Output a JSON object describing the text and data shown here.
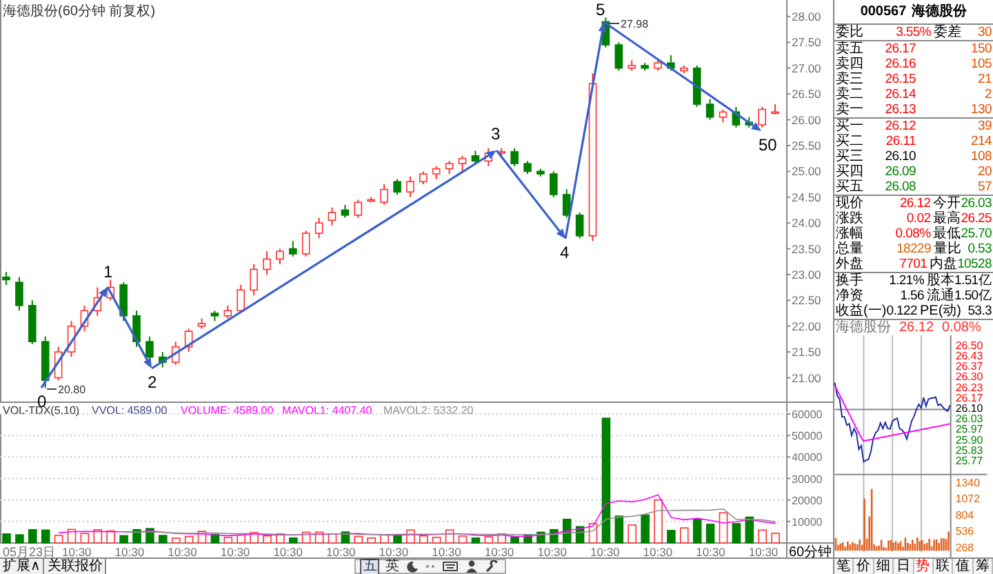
{
  "chart": {
    "title": "海德股份(60分钟 前复权)",
    "chart_data": {
      "type": "candlestick",
      "ylim": [
        20.54,
        28.32
      ],
      "yticks": [
        {
          "value": 28,
          "label": "28.00"
        },
        {
          "value": 27.5,
          "label": "27.50"
        },
        {
          "value": 27,
          "label": "27.00"
        },
        {
          "value": 26.5,
          "label": "26.50"
        },
        {
          "value": 26,
          "label": "26.00"
        },
        {
          "value": 25.5,
          "label": "25.50"
        },
        {
          "value": 25,
          "label": "25.00"
        },
        {
          "value": 24.5,
          "label": "24.50"
        },
        {
          "value": 24,
          "label": "24.00"
        },
        {
          "value": 23.5,
          "label": "23.50"
        },
        {
          "value": 23,
          "label": "23.00"
        },
        {
          "value": 22.5,
          "label": "22.50"
        },
        {
          "value": 22,
          "label": "22.00"
        },
        {
          "value": 21.5,
          "label": "21.50"
        },
        {
          "value": 21,
          "label": "21.00"
        }
      ],
      "ohlc": [
        [
          22.95,
          23.05,
          22.8,
          22.9
        ],
        [
          22.85,
          22.95,
          22.3,
          22.4
        ],
        [
          22.4,
          22.5,
          21.65,
          21.7
        ],
        [
          21.7,
          21.8,
          20.8,
          20.95
        ],
        [
          21.0,
          21.6,
          20.95,
          21.5
        ],
        [
          21.5,
          22.1,
          21.4,
          22.0
        ],
        [
          22.0,
          22.4,
          21.9,
          22.3
        ],
        [
          22.3,
          22.75,
          22.2,
          22.55
        ],
        [
          22.55,
          22.9,
          22.5,
          22.75
        ],
        [
          22.8,
          22.85,
          22.1,
          22.2
        ],
        [
          22.2,
          22.3,
          21.6,
          21.7
        ],
        [
          21.7,
          21.8,
          21.3,
          21.4
        ],
        [
          21.4,
          21.5,
          21.2,
          21.3
        ],
        [
          21.3,
          21.7,
          21.25,
          21.6
        ],
        [
          21.6,
          21.95,
          21.5,
          21.9
        ],
        [
          22.0,
          22.15,
          21.95,
          22.05
        ],
        [
          22.25,
          22.3,
          22.1,
          22.2
        ],
        [
          22.2,
          22.4,
          22.15,
          22.3
        ],
        [
          22.3,
          22.8,
          22.25,
          22.7
        ],
        [
          22.7,
          23.2,
          22.6,
          23.1
        ],
        [
          23.1,
          23.45,
          23.0,
          23.3
        ],
        [
          23.3,
          23.5,
          23.2,
          23.45
        ],
        [
          23.5,
          23.65,
          23.35,
          23.4
        ],
        [
          23.4,
          23.85,
          23.35,
          23.8
        ],
        [
          23.8,
          24.1,
          23.7,
          24.0
        ],
        [
          24.05,
          24.3,
          23.95,
          24.2
        ],
        [
          24.25,
          24.35,
          24.1,
          24.15
        ],
        [
          24.15,
          24.45,
          24.1,
          24.4
        ],
        [
          24.45,
          24.5,
          24.4,
          24.45
        ],
        [
          24.4,
          24.75,
          24.35,
          24.65
        ],
        [
          24.8,
          24.85,
          24.55,
          24.6
        ],
        [
          24.6,
          24.9,
          24.5,
          24.8
        ],
        [
          24.8,
          25.0,
          24.75,
          24.95
        ],
        [
          24.95,
          25.1,
          24.85,
          25.05
        ],
        [
          25.05,
          25.2,
          24.95,
          25.15
        ],
        [
          25.15,
          25.3,
          25.0,
          25.25
        ],
        [
          25.3,
          25.4,
          25.15,
          25.2
        ],
        [
          25.2,
          25.45,
          25.1,
          25.35
        ],
        [
          25.36,
          25.45,
          25.3,
          25.38
        ],
        [
          25.38,
          25.45,
          25.1,
          25.15
        ],
        [
          25.15,
          25.2,
          24.95,
          25.0
        ],
        [
          25.0,
          25.05,
          24.9,
          24.95
        ],
        [
          24.95,
          25.0,
          24.5,
          24.55
        ],
        [
          24.55,
          24.65,
          24.1,
          24.15
        ],
        [
          24.15,
          24.2,
          23.7,
          23.75
        ],
        [
          23.75,
          26.9,
          23.65,
          26.7
        ],
        [
          27.9,
          27.98,
          27.4,
          27.45
        ],
        [
          27.45,
          27.5,
          26.95,
          27.0
        ],
        [
          27.0,
          27.15,
          26.95,
          27.05
        ],
        [
          27.05,
          27.1,
          26.95,
          27.0
        ],
        [
          27.0,
          27.15,
          26.95,
          27.1
        ],
        [
          27.1,
          27.25,
          26.95,
          27.0
        ],
        [
          26.95,
          27.05,
          26.9,
          27.0
        ],
        [
          27.0,
          27.05,
          26.25,
          26.3
        ],
        [
          26.3,
          26.4,
          26.0,
          26.05
        ],
        [
          26.05,
          26.2,
          25.95,
          26.15
        ],
        [
          26.15,
          26.25,
          25.85,
          25.9
        ],
        [
          25.95,
          26.05,
          25.85,
          25.9
        ],
        [
          25.9,
          26.25,
          25.85,
          26.2
        ],
        [
          26.15,
          26.3,
          26.1,
          26.15
        ]
      ]
    },
    "wave_points": [
      {
        "label": "0",
        "price": "20.80"
      },
      {
        "label": "1"
      },
      {
        "label": "2"
      },
      {
        "label": "3"
      },
      {
        "label": "4"
      },
      {
        "label": "5",
        "price": "27.98"
      },
      {
        "label": "50"
      }
    ],
    "volume": {
      "indicator": "VOL-TDX(5,10)",
      "readings": [
        {
          "text": "VVOL: 4589.00",
          "color": "#404090"
        },
        {
          "text": "VOLUME: 4589.00",
          "color": "#ff00ff"
        },
        {
          "text": "MAVOL1: 4407.40",
          "color": "#ff00ff"
        },
        {
          "text": "MAVOL2: 5332.20",
          "color": "#909090"
        }
      ],
      "chart_data": {
        "type": "bar",
        "ylim": [
          0,
          60000
        ],
        "yticks": [
          10000,
          20000,
          30000,
          40000,
          50000,
          60000
        ],
        "grid": true,
        "series": [
          {
            "type": "bar",
            "color": "#ff3030",
            "values": [
              null,
              null,
              null,
              null,
              3500,
              6300,
              4400,
              6100,
              5600,
              null,
              null,
              null,
              null,
              2200,
              3000,
              5400,
              null,
              2600,
              3700,
              4800,
              3300,
              4200,
              null,
              5000,
              5000,
              4100,
              null,
              3000,
              2300,
              3900,
              null,
              6000,
              3300,
              2600,
              6000,
              3200,
              null,
              2800,
              4200,
              null,
              null,
              null,
              null,
              null,
              null,
              9000,
              null,
              null,
              8300,
              null,
              20000,
              null,
              7000,
              null,
              null,
              14000,
              null,
              null,
              6000,
              4500
            ]
          },
          {
            "type": "bar",
            "color": "#008000",
            "values": [
              4200,
              3800,
              6200,
              6000,
              null,
              null,
              null,
              null,
              null,
              3400,
              6200,
              6700,
              3500,
              null,
              null,
              null,
              4000,
              null,
              null,
              null,
              null,
              null,
              2300,
              null,
              null,
              null,
              5100,
              null,
              null,
              null,
              3600,
              null,
              null,
              null,
              null,
              null,
              2300,
              null,
              null,
              2600,
              3800,
              5000,
              6200,
              11000,
              7600,
              null,
              58000,
              12500,
              null,
              13000,
              null,
              5800,
              null,
              11000,
              8700,
              null,
              9000,
              12000,
              null,
              null
            ]
          },
          {
            "type": "line",
            "color": "#ff00ff",
            "values": [
              null,
              null,
              null,
              null,
              4700,
              5200,
              5300,
              5300,
              5200,
              5200,
              5100,
              5600,
              5100,
              4400,
              4300,
              4200,
              3600,
              3400,
              3700,
              4100,
              3700,
              3700,
              3700,
              3900,
              4000,
              4100,
              4300,
              4400,
              3900,
              3700,
              3600,
              3800,
              3800,
              3900,
              4300,
              4200,
              3500,
              3400,
              3700,
              3000,
              3100,
              3700,
              4400,
              5700,
              6700,
              7800,
              18400,
              19600,
              19100,
              20200,
              22400,
              11900,
              10800,
              11400,
              10500,
              9300,
              9900,
              10900,
              9900,
              9100
            ]
          },
          {
            "type": "line",
            "color": "#909090",
            "values": [
              null,
              null,
              null,
              null,
              null,
              null,
              null,
              null,
              null,
              5000,
              5000,
              5200,
              4900,
              4600,
              4500,
              4600,
              4600,
              4400,
              4300,
              4400,
              4200,
              3900,
              3800,
              4100,
              4200,
              4200,
              4200,
              4000,
              4000,
              3900,
              4000,
              4100,
              4100,
              4100,
              4200,
              4200,
              4100,
              4000,
              4000,
              3900,
              3900,
              4000,
              4000,
              4700,
              4900,
              5500,
              11000,
              12000,
              12400,
              13400,
              15100,
              15100,
              15200,
              15200,
              15300,
              15800,
              10900,
              10900,
              10700,
              9800
            ]
          }
        ]
      }
    },
    "dates": [
      "05月23日",
      "10:30",
      "10:30",
      "10:30",
      "10:30",
      "10:30",
      "10:30",
      "10:30",
      "10:30",
      "10:30",
      "10:30",
      "10:30",
      "10:30",
      "10:30",
      "10:30"
    ],
    "period": "60分钟"
  },
  "bottom_tabs": [
    "扩展∧",
    "关联报价"
  ],
  "toolbar": [
    {
      "kind": "text",
      "label": "五",
      "selected": true
    },
    {
      "kind": "text",
      "label": "英",
      "selected": false
    },
    {
      "kind": "moon",
      "selected": false
    },
    {
      "kind": "dots",
      "selected": false
    },
    {
      "kind": "keyboard",
      "selected": false
    },
    {
      "kind": "person",
      "selected": false
    },
    {
      "kind": "wrench",
      "selected": false
    }
  ],
  "quote": {
    "code": "000567",
    "name": "海德股份",
    "ratio": {
      "left": {
        "label": "委比",
        "value": "3.55%",
        "color": "#ff0000"
      },
      "right": {
        "label": "委差",
        "value": "30",
        "color": "#e05000"
      }
    },
    "asks": [
      {
        "label": "卖五",
        "price": "26.17",
        "volume": "150",
        "color": "#ff0000"
      },
      {
        "label": "卖四",
        "price": "26.16",
        "volume": "105",
        "color": "#ff0000"
      },
      {
        "label": "卖三",
        "price": "26.15",
        "volume": "21",
        "color": "#ff0000"
      },
      {
        "label": "卖二",
        "price": "26.14",
        "volume": "2",
        "color": "#ff0000"
      },
      {
        "label": "卖一",
        "price": "26.13",
        "volume": "130",
        "color": "#ff0000"
      }
    ],
    "bids": [
      {
        "label": "买一",
        "price": "26.12",
        "volume": "39",
        "color": "#ff0000"
      },
      {
        "label": "买二",
        "price": "26.11",
        "volume": "214",
        "color": "#ff0000"
      },
      {
        "label": "买三",
        "price": "26.10",
        "volume": "108",
        "color": "#000000"
      },
      {
        "label": "买四",
        "price": "26.09",
        "volume": "20",
        "color": "#008000"
      },
      {
        "label": "买五",
        "price": "26.08",
        "volume": "57",
        "color": "#008000"
      }
    ],
    "stats": [
      {
        "left": {
          "label": "现价",
          "value": "26.12",
          "color": "#ff0000"
        },
        "right": {
          "label": "今开",
          "value": "26.03",
          "color": "#008000"
        }
      },
      {
        "left": {
          "label": "涨跌",
          "value": "0.02",
          "color": "#ff0000"
        },
        "right": {
          "label": "最高",
          "value": "26.25",
          "color": "#ff0000"
        }
      },
      {
        "left": {
          "label": "涨幅",
          "value": "0.08%",
          "color": "#ff0000"
        },
        "right": {
          "label": "最低",
          "value": "25.70",
          "color": "#008000"
        }
      },
      {
        "left": {
          "label": "总量",
          "value": "18229",
          "color": "#e06000"
        },
        "right": {
          "label": "量比",
          "value": "0.53",
          "color": "#008000"
        }
      },
      {
        "left": {
          "label": "外盘",
          "value": "7701",
          "color": "#ff0000"
        },
        "right": {
          "label": "内盘",
          "value": "10528",
          "color": "#008000"
        }
      }
    ],
    "finance": [
      {
        "left": {
          "label": "换手",
          "value": "1.21%"
        },
        "right": {
          "label": "股本",
          "value": "1.51亿"
        }
      },
      {
        "left": {
          "label": "净资",
          "value": "1.56"
        },
        "right": {
          "label": "流通",
          "value": "1.50亿"
        }
      },
      {
        "left": {
          "label": "收益(一)",
          "value": "0.122"
        },
        "right": {
          "label": "PE(动)",
          "value": "53.3"
        }
      }
    ]
  },
  "mini_chart": {
    "name": "海德股份",
    "price": "26.12",
    "change": "0.08%",
    "price_axis": [
      {
        "label": "26.50",
        "color": "#ff0000"
      },
      {
        "label": "26.43",
        "color": "#ff0000"
      },
      {
        "label": "26.37",
        "color": "#ff0000"
      },
      {
        "label": "26.30",
        "color": "#ff0000"
      },
      {
        "label": "26.23",
        "color": "#ff0000"
      },
      {
        "label": "26.17",
        "color": "#ff0000"
      },
      {
        "label": "26.10",
        "color": "#000000"
      },
      {
        "label": "26.03",
        "color": "#008000"
      },
      {
        "label": "25.97",
        "color": "#008000"
      },
      {
        "label": "25.90",
        "color": "#008000"
      },
      {
        "label": "25.83",
        "color": "#008000"
      },
      {
        "label": "25.77",
        "color": "#008000"
      }
    ],
    "volume_axis": [
      "1340",
      "1072",
      "804",
      "536",
      "268"
    ]
  },
  "period_tabs": [
    {
      "label": "笔",
      "selected": false
    },
    {
      "label": "价",
      "selected": false
    },
    {
      "label": "细",
      "selected": false
    },
    {
      "label": "日",
      "selected": false
    },
    {
      "label": "势",
      "selected": true
    },
    {
      "label": "联",
      "selected": false
    },
    {
      "label": "值",
      "selected": false
    },
    {
      "label": "筹",
      "selected": false
    }
  ]
}
